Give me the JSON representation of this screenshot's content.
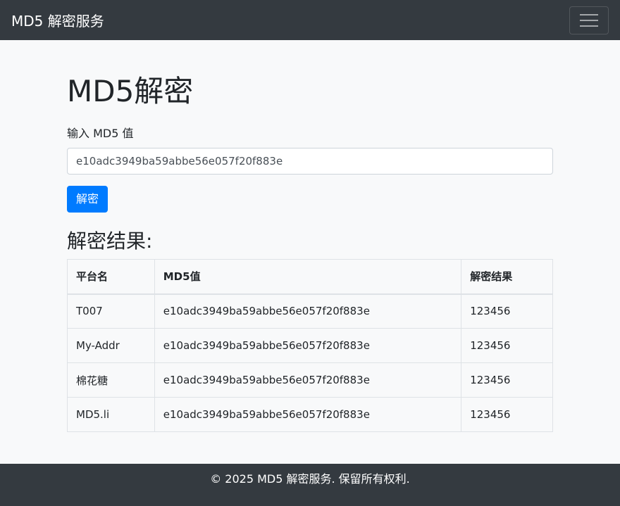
{
  "navbar": {
    "brand": "MD5 解密服务",
    "toggler_icon": "hamburger-icon"
  },
  "main": {
    "title": "MD5解密",
    "input_label": "输入 MD5 值",
    "input_value": "e10adc3949ba59abbe56e057f20f883e",
    "submit_label": "解密",
    "results_title": "解密结果:"
  },
  "table": {
    "headers": [
      "平台名",
      "MD5值",
      "解密结果"
    ],
    "rows": [
      [
        "T007",
        "e10adc3949ba59abbe56e057f20f883e",
        "123456"
      ],
      [
        "My-Addr",
        "e10adc3949ba59abbe56e057f20f883e",
        "123456"
      ],
      [
        "棉花糖",
        "e10adc3949ba59abbe56e057f20f883e",
        "123456"
      ],
      [
        "MD5.li",
        "e10adc3949ba59abbe56e057f20f883e",
        "123456"
      ]
    ]
  },
  "footer": {
    "text": "© 2025 MD5 解密服务. 保留所有权利."
  },
  "colors": {
    "navbar": "#343a40",
    "primary": "#007bff",
    "background": "#f8f9fa"
  }
}
